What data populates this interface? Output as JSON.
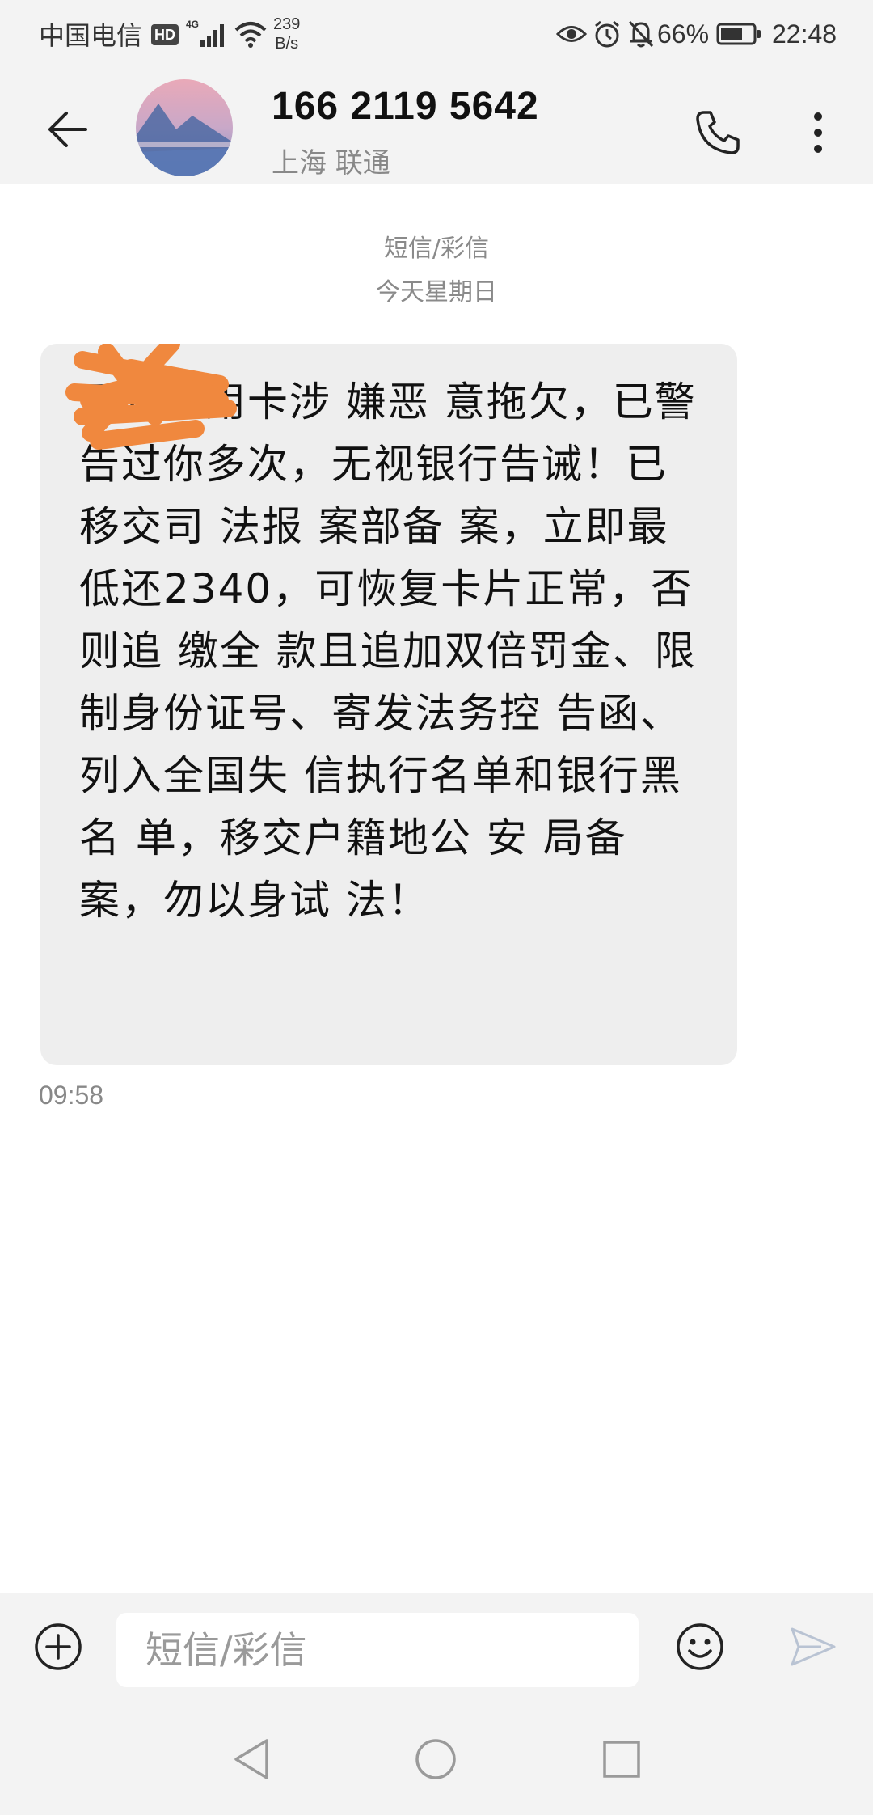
{
  "status_bar": {
    "carrier": "中国电信",
    "hd_badge": "HD",
    "network_speed_value": "239",
    "network_speed_unit": "B/s",
    "battery_percent": "66%",
    "time": "22:48",
    "icons": [
      "4g-signal-icon",
      "wifi-icon",
      "eye-icon",
      "alarm-icon",
      "mute-bell-icon",
      "battery-icon"
    ]
  },
  "header": {
    "contact_number": "166 2119 5642",
    "contact_location": "上海 联通",
    "icons": [
      "back-arrow-icon",
      "phone-icon",
      "more-vertical-icon"
    ]
  },
  "conversation": {
    "message_type": "短信/彩信",
    "date_label": "今天星期日",
    "messages": [
      {
        "text": "平安信用卡涉 嫌恶 意拖欠，已警 告过你多次，无视银行告诫！已移交司 法报 案部备 案，立即最低还2340，可恢复卡片正常，否则追 缴全 款且追加双倍罚金、限制身份证号、寄发法务控 告函、列入全国失 信执行名单和银行黑 名 单，移交户籍地公 安 局备 案，勿以身试 法！",
        "time": "09:58"
      }
    ]
  },
  "composer": {
    "placeholder": "短信/彩信",
    "icons": [
      "add-circle-icon",
      "emoji-icon",
      "send-icon"
    ]
  },
  "colors": {
    "bar_background": "#f3f3f3",
    "bubble_background": "#eeeeee",
    "redaction_orange": "#f0883e",
    "secondary_text": "#888888"
  }
}
